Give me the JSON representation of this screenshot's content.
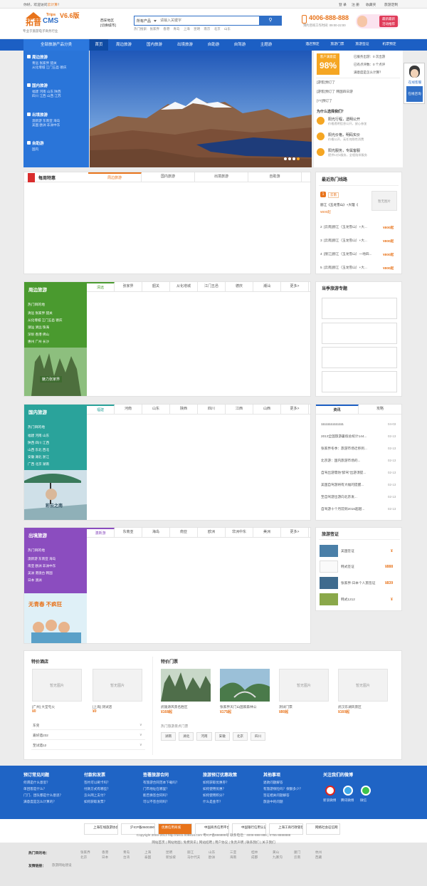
{
  "topbar": {
    "welcome": "你好，欢迎访问",
    "welcome_link": "云计算",
    "welcome_end": "！",
    "login": "登 录",
    "register": "注 册",
    "favorite": "收藏夹",
    "custom": "旅游定制"
  },
  "header": {
    "logo_main": "拓普",
    "logo_cms": "CMS",
    "logo_trips": "Trips",
    "logo_version": "V6.6版",
    "logo_slogan": "专业于旅游电子商务行业",
    "city_name": "西安地区",
    "city_switch": "[切换城市]",
    "search_select": "所有产品",
    "search_placeholder": "请输入关键字",
    "search_button": "搜索",
    "hot_label": "热门搜索:",
    "hot_words": [
      "张家界",
      "香港",
      "青岛",
      "上海",
      "昆明",
      "南京",
      "北京",
      "山东"
    ],
    "phone": "4006-888-888",
    "service_time": "预约咨询工作时间: 09:00-22:00",
    "promo_line1": "最新最新",
    "promo_line2": "活动推荐"
  },
  "nav": {
    "category": "全部旅游产品分类",
    "items": [
      "首页",
      "周边旅游",
      "国内旅游",
      "出境旅游",
      "自助游",
      "自驾游",
      "主题游"
    ],
    "right_items": [
      "酒店预定",
      "旅游门票",
      "旅游签证",
      "机票预定"
    ]
  },
  "categories": [
    {
      "title": "周边旅游",
      "links": [
        "青远 张家界 韶关",
        "从化增城 江门五邑 德庆"
      ]
    },
    {
      "title": "国内旅游",
      "links": [
        "福建 河南 山东 陕西",
        "四川 江西 山西 江苏"
      ]
    },
    {
      "title": "出境旅游",
      "links": [
        "澳新游 东南亚 海岛",
        "美国 欧洲 非洲中东"
      ]
    },
    {
      "title": "自助游",
      "links": [
        "国内"
      ]
    }
  ],
  "stats": {
    "label": "客户满意度",
    "percent": "98%",
    "lines": [
      "已服务出游：0 次出游",
      "已有点评数：0 个点评",
      "满意度是怎么计算？"
    ],
    "recent": [
      "[游客]预订了",
      "[游客]预订了 韩国四日游",
      "[??]预订了"
    ],
    "why_title": "为什么选择我们？",
    "reasons": [
      {
        "t": "阳光行程，透明公开",
        "d": "价格透明信息公开，放心参加"
      },
      {
        "t": "阳光价格，明码实价",
        "d": "价格公开，无任何隐性消费"
      },
      {
        "t": "阳光服务，专属客服",
        "d": "提供1对1服务，全程陪伴服务"
      }
    ]
  },
  "weekly": {
    "title": "每周特惠",
    "tabs": [
      "周边旅游",
      "国内旅游",
      "出境旅游",
      "自助游"
    ]
  },
  "hotline": {
    "title": "最近热门线路",
    "first_num": "1",
    "first_tag": "云南",
    "first_name": "丽江《玉龙雪山》+大理《",
    "first_price": "¥800起",
    "noimg": "暂无图片",
    "items": [
      {
        "n": "2",
        "name": "[云南]丽江（玉龙雪山）+大...",
        "p": "¥800起"
      },
      {
        "n": "3",
        "name": "[云南]丽江（玉龙雪山）+大...",
        "p": "¥800起"
      },
      {
        "n": "4",
        "name": "[丽江]丽江（玉龙雪山）一地四...",
        "p": "¥800起"
      },
      {
        "n": "5",
        "name": "[云南]丽江（玉龙雪山）+大...",
        "p": "¥800起"
      }
    ]
  },
  "sections": [
    {
      "title": "周边旅游",
      "color": "#4a9a2f",
      "tabs": [
        "清远",
        "张家界",
        "韶关",
        "从化增城",
        "江门五邑",
        "德庆",
        "潮汕",
        "更多>"
      ],
      "hot": "热门目的地",
      "dests": [
        "清远 张家界 韶关",
        "从化增城 江门五邑 德庆",
        "潮汕 清远 珠海",
        "深圳 香港 佛山",
        "惠州 广州 长沙"
      ],
      "img_text": "魅力张家界"
    },
    {
      "title": "国内旅游",
      "color": "#2aa39b",
      "tabs": [
        "福建",
        "河南",
        "山东",
        "陕西",
        "四川",
        "江西",
        "山西",
        "更多>"
      ],
      "hot": "热门目的地",
      "dests": [
        "福建 河南 山东",
        "陕西 四川 江西",
        "山西 东北 西北",
        "安徽 湖北 浙江",
        "广西 北京 湖南"
      ],
      "img_text": "彩云之南"
    },
    {
      "title": "出境旅游",
      "color": "#8b4dbf",
      "tabs": [
        "澳新游",
        "东南亚",
        "海岛",
        "南亚",
        "欧洲",
        "非洲中东",
        "美洲",
        "更多>"
      ],
      "hot": "热门目的地",
      "dests": [
        "澳新游 东南亚 海岛",
        "南亚 欧洲 非洲中东",
        "美洲 港澳台 韩国",
        "日本 澳洲"
      ],
      "img_text": "无青春 不疯狂"
    }
  ],
  "theme": {
    "title": "当季旅游专题"
  },
  "news": {
    "tabs": [
      "资讯",
      "攻略"
    ],
    "items": [
      {
        "t": "11111111111111",
        "d": "04-03"
      },
      {
        "t": "2013全国旅游暑假总统计144...",
        "d": "02-13"
      },
      {
        "t": "张家界冬季：旅游市场迁移到...",
        "d": "02-13"
      },
      {
        "t": "北京游：国内旅游市场的...",
        "d": "02-13"
      },
      {
        "t": "自驾出游需防“醉驾”出游须提...",
        "d": "02-13"
      },
      {
        "t": "美国自驾游将有大幅的提醒...",
        "d": "02-13"
      },
      {
        "t": "至自驾游出游向北京发...",
        "d": "02-13"
      },
      {
        "t": "自驾游十个月前到2016超越...",
        "d": "02-13"
      }
    ]
  },
  "visa": {
    "title": "旅游签证",
    "items": [
      {
        "name": "美国签证",
        "p": "¥"
      },
      {
        "name": "韩式签证",
        "p": "¥888"
      },
      {
        "name": "张家界-日本个人旅签证",
        "p": "¥839"
      },
      {
        "name": "韩式1212",
        "p": "¥"
      }
    ]
  },
  "hotel": {
    "title": "特价酒店",
    "noimg": "暂无图片",
    "items": [
      {
        "name": "[广州] 大堂屯火",
        "p": "¥0"
      },
      {
        "name": "[上海] 测试店",
        "p": "¥0"
      }
    ],
    "cities": [
      "东莞",
      "嘉好酒232",
      "至试酒12"
    ],
    "more": "∨"
  },
  "tickets": {
    "title": "特价门票",
    "items": [
      {
        "name": "武陵源风景名胜区",
        "p": "¥168起"
      },
      {
        "name": "张家界天门山国家森林公",
        "p": "¥175起"
      },
      {
        "name": "测试门票",
        "p": "¥80起"
      },
      {
        "name": "武汉东湖风景区",
        "p": "¥160起"
      }
    ],
    "hot_label": "热门旅游景点门票",
    "places": [
      "湖南",
      "湖北",
      "河南",
      "安徽",
      "北京",
      "四川"
    ]
  },
  "footer": {
    "cols": [
      {
        "h": "预订常见问题",
        "l": [
          "何谓是什么意思？",
          "单团客是什么？",
          "门门、团队都是什么意思？",
          "满意度是怎么计算的？"
        ]
      },
      {
        "h": "付款和发票",
        "l": [
          "签约可以刷卡吗？",
          "付款方式有哪些？",
          "怎么网上支付？",
          "如何获取发票？"
        ]
      },
      {
        "h": "签署旅游合同",
        "l": [
          "有旅游合同范本下载吗？",
          "门市地址在哪里？",
          "能否换签合同吗？",
          "可以不签合同吗？"
        ]
      },
      {
        "h": "旅游预订优惠政策",
        "l": [
          "如何获取优惠券？",
          "如何使用优惠？",
          "如何使用积分？",
          "什么是金币？"
        ]
      },
      {
        "h": "其他事项",
        "l": [
          "退款问题解答",
          "有旅游保险吗？保额多少？",
          "签证相关问题解答",
          "旅途中的问题"
        ]
      }
    ],
    "follow": "关注我们的微博",
    "social": [
      "新浪微博",
      "腾讯微博",
      "微信"
    ]
  },
  "badges": [
    "上海在线旅游协会",
    "沪ICP备06003906",
    "优惠信用商城",
    "中国商务信用平台",
    "中国银行信用认证",
    "上海工商行政管理",
    "网络社会征信网"
  ],
  "copyright": "Copyright 2005-2013 http://test1.009816.com 粤ICP备666888号 联系电话：4006-888-888 | 0755-8888888",
  "bottom_links": [
    "网站首页",
    "网站地图",
    "免费资讯",
    "网站招聘",
    "用户协议",
    "免责声明",
    "联系我们",
    "关于我们"
  ],
  "hot_dest_label": "热门目的地：",
  "hot_dests": [
    "张家界",
    "香港",
    "青岛",
    "上海",
    "昆明",
    "丽江",
    "山东",
    "三亚",
    "桂林",
    "黄山",
    "厦门",
    "杭州",
    "北京",
    "日本",
    "台湾",
    "泰国",
    "新加坡",
    "马尔代夫",
    "欧洲",
    "海南",
    "成都",
    "九寨沟",
    "云南",
    "西藏"
  ],
  "friend_label": "友情链接：",
  "friend_link": "旅游网站建设",
  "consult": {
    "online": "在线客服",
    "btn": "在线咨询"
  }
}
